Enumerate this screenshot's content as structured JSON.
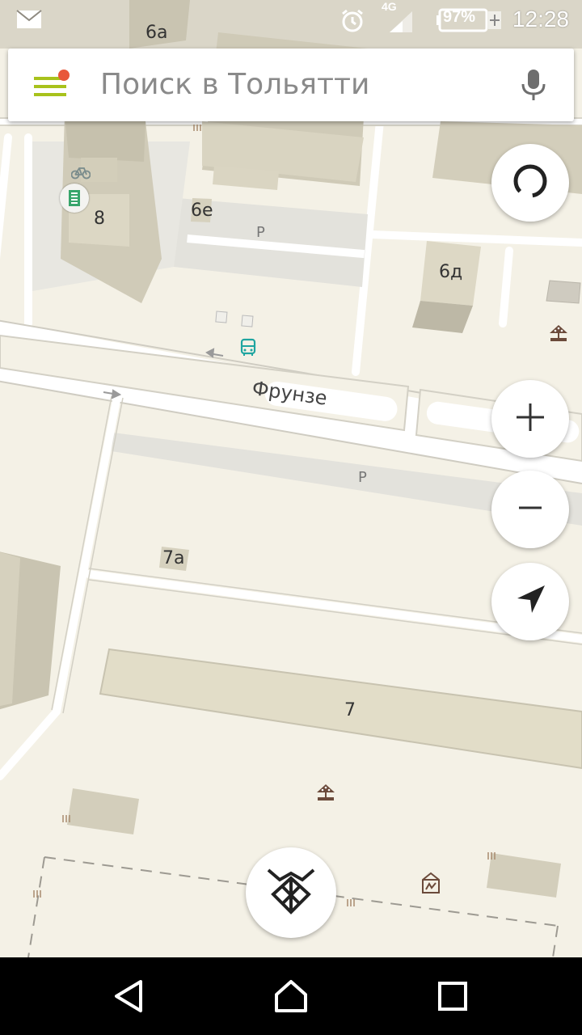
{
  "status_bar": {
    "network": "4G",
    "battery": "97%",
    "time": "12:28",
    "icons": [
      "mail-icon",
      "alarm-icon",
      "signal-icon",
      "battery-icon"
    ]
  },
  "search": {
    "placeholder": "Поиск в Тольятти",
    "icons": [
      "menu-icon",
      "microphone-icon"
    ],
    "notification_dot_color": "#e8573a",
    "menu_color": "#a8c21c"
  },
  "map": {
    "street": "Фрунзе",
    "buildings": [
      "6а",
      "8",
      "6е",
      "6д",
      "7а",
      "7"
    ],
    "parking": [
      "P",
      "P"
    ],
    "colors": {
      "background": "#f4f1e6",
      "road": "#ffffff",
      "road_edge": "#c9c6bc",
      "building": "#d6d1bd",
      "building_dark": "#bdb8a6",
      "parking_area": "#e3e2dc",
      "transit": "#1fa5a0"
    }
  },
  "controls": {
    "icons": [
      "compass-icon",
      "zoom-in-icon",
      "zoom-out-icon",
      "my-location-icon",
      "yandex-logo-icon"
    ]
  },
  "nav": {
    "icons": [
      "back-icon",
      "home-icon",
      "recents-icon"
    ]
  }
}
